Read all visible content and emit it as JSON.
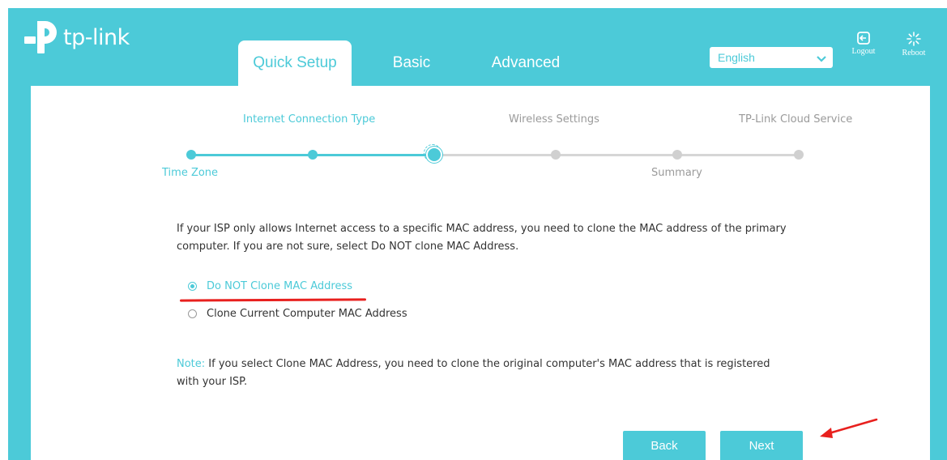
{
  "header": {
    "logo_text": "tp-link",
    "tabs": [
      {
        "label": "Quick Setup",
        "active": true
      },
      {
        "label": "Basic",
        "active": false
      },
      {
        "label": "Advanced",
        "active": false
      }
    ],
    "language": {
      "selected": "English"
    },
    "logout_label": "Logout",
    "reboot_label": "Reboot"
  },
  "stepper": {
    "steps_top": [
      "Internet Connection Type",
      "Wireless Settings",
      "TP-Link Cloud Service"
    ],
    "steps_bottom": [
      "Time Zone",
      "Summary"
    ],
    "current_step": "Internet Connection Type"
  },
  "main": {
    "description": "If your ISP only allows Internet access to a specific MAC address, you need to clone the MAC address of the primary computer. If you are not sure, select Do NOT clone MAC Address.",
    "options": [
      {
        "label": "Do NOT Clone MAC Address",
        "checked": true
      },
      {
        "label": "Clone Current Computer MAC Address",
        "checked": false
      }
    ],
    "note_label": "Note:",
    "note_text": "If you select Clone MAC Address, you need to clone the original computer's MAC address that is registered with your ISP."
  },
  "buttons": {
    "back": "Back",
    "next": "Next"
  },
  "colors": {
    "brand": "#4ccad8",
    "annotation": "#e8201e"
  }
}
